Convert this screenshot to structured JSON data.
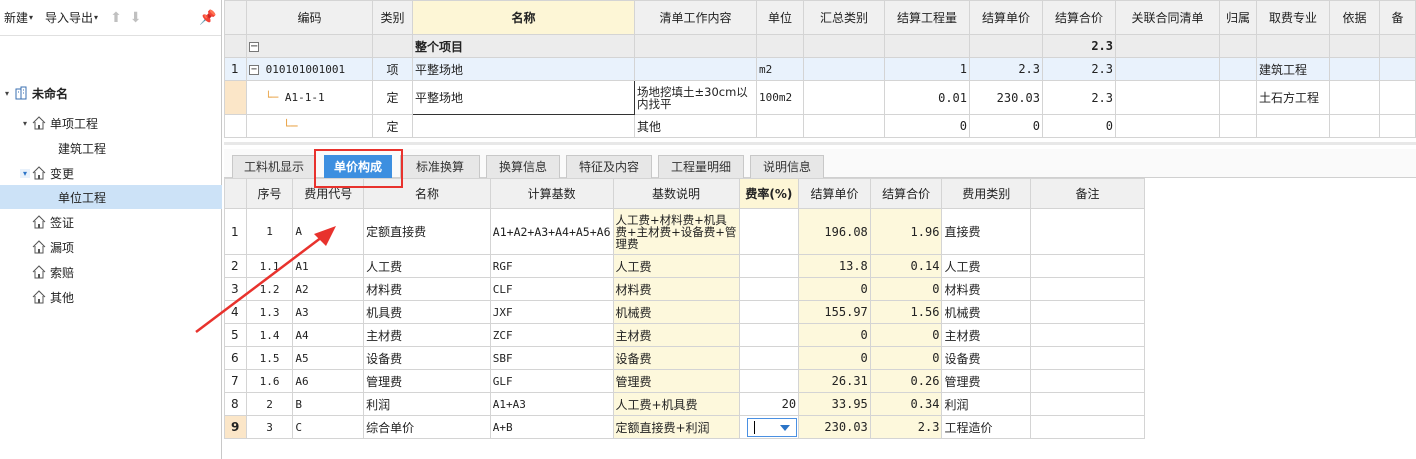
{
  "toolbar": {
    "new_label": "新建",
    "import_export_label": "导入导出"
  },
  "tree": {
    "root": "未命名",
    "items": [
      {
        "label": "单项工程"
      },
      {
        "label": "建筑工程"
      },
      {
        "label": "变更"
      },
      {
        "label": "单位工程"
      },
      {
        "label": "签证"
      },
      {
        "label": "漏项"
      },
      {
        "label": "索赔"
      },
      {
        "label": "其他"
      }
    ]
  },
  "top_grid": {
    "headers": [
      "编码",
      "类别",
      "名称",
      "清单工作内容",
      "单位",
      "汇总类别",
      "结算工程量",
      "结算单价",
      "结算合价",
      "关联合同清单",
      "归属",
      "取费专业",
      "依据",
      "备"
    ],
    "rows": [
      {
        "no": "",
        "code": "",
        "type": "",
        "name": "整个项目",
        "content": "",
        "unit": "",
        "sum": "",
        "qty": "",
        "price": "",
        "total": "2.3",
        "link": "",
        "belong": "",
        "major": ""
      },
      {
        "no": "1",
        "code": "010101001001",
        "type": "项",
        "name": "平整场地",
        "content": "",
        "unit": "m2",
        "sum": "",
        "qty": "1",
        "price": "2.3",
        "total": "2.3",
        "link": "",
        "belong": "",
        "major": "建筑工程"
      },
      {
        "no": "",
        "code": "A1-1-1",
        "type": "定",
        "name": "平整场地",
        "content": "场地挖填土±30cm以内找平",
        "unit": "100m2",
        "sum": "",
        "qty": "0.01",
        "price": "230.03",
        "total": "2.3",
        "link": "",
        "belong": "",
        "major": "土石方工程"
      },
      {
        "no": "",
        "code": "",
        "type": "定",
        "name": "",
        "content": "其他",
        "unit": "",
        "sum": "",
        "qty": "0",
        "price": "0",
        "total": "0",
        "link": "",
        "belong": "",
        "major": ""
      }
    ]
  },
  "tabs": [
    "工料机显示",
    "单价构成",
    "标准换算",
    "换算信息",
    "特征及内容",
    "工程量明细",
    "说明信息"
  ],
  "bottom_grid": {
    "headers": [
      "序号",
      "费用代号",
      "名称",
      "计算基数",
      "基数说明",
      "费率(%)",
      "结算单价",
      "结算合价",
      "费用类别",
      "备注"
    ],
    "rows": [
      {
        "rn": "1",
        "seq": "1",
        "code": "A",
        "name": "定额直接费",
        "base": "A1+A2+A3+A4+A5+A6",
        "desc": "人工费+材料费+机具费+主材费+设备费+管理费",
        "rate": "",
        "price": "196.08",
        "total": "1.96",
        "cat": "直接费",
        "note": ""
      },
      {
        "rn": "2",
        "seq": "1.1",
        "code": "A1",
        "name": "人工费",
        "base": "RGF",
        "desc": "人工费",
        "rate": "",
        "price": "13.8",
        "total": "0.14",
        "cat": "人工费",
        "note": ""
      },
      {
        "rn": "3",
        "seq": "1.2",
        "code": "A2",
        "name": "材料费",
        "base": "CLF",
        "desc": "材料费",
        "rate": "",
        "price": "0",
        "total": "0",
        "cat": "材料费",
        "note": ""
      },
      {
        "rn": "4",
        "seq": "1.3",
        "code": "A3",
        "name": "机具费",
        "base": "JXF",
        "desc": "机械费",
        "rate": "",
        "price": "155.97",
        "total": "1.56",
        "cat": "机械费",
        "note": ""
      },
      {
        "rn": "5",
        "seq": "1.4",
        "code": "A4",
        "name": "主材费",
        "base": "ZCF",
        "desc": "主材费",
        "rate": "",
        "price": "0",
        "total": "0",
        "cat": "主材费",
        "note": ""
      },
      {
        "rn": "6",
        "seq": "1.5",
        "code": "A5",
        "name": "设备费",
        "base": "SBF",
        "desc": "设备费",
        "rate": "",
        "price": "0",
        "total": "0",
        "cat": "设备费",
        "note": ""
      },
      {
        "rn": "7",
        "seq": "1.6",
        "code": "A6",
        "name": "管理费",
        "base": "GLF",
        "desc": "管理费",
        "rate": "",
        "price": "26.31",
        "total": "0.26",
        "cat": "管理费",
        "note": ""
      },
      {
        "rn": "8",
        "seq": "2",
        "code": "B",
        "name": "利润",
        "base": "A1+A3",
        "desc": "人工费+机具费",
        "rate": "20",
        "price": "33.95",
        "total": "0.34",
        "cat": "利润",
        "note": ""
      },
      {
        "rn": "9",
        "seq": "3",
        "code": "C",
        "name": "综合单价",
        "base": "A+B",
        "desc": "定额直接费+利润",
        "rate": "",
        "price": "230.03",
        "total": "2.3",
        "cat": "工程造价",
        "note": ""
      }
    ]
  },
  "colors": {
    "accent": "#3d8fe0",
    "annotation": "#e8322d",
    "selection": "#cce2f7"
  }
}
